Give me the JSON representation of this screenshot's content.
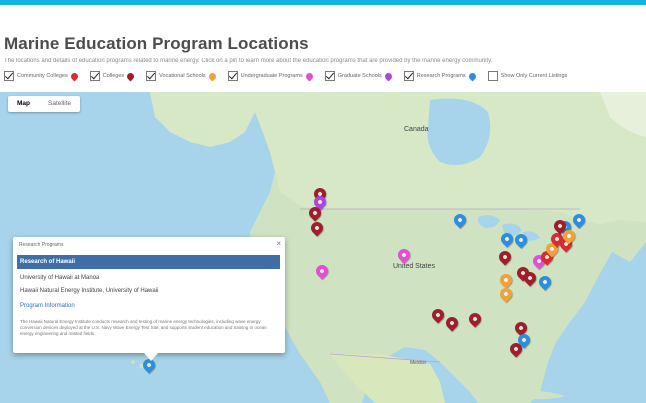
{
  "page": {
    "title": "Marine Education Program Locations",
    "description": "The locations and details of education programs related to marine energy. Click on a pin to learn more about the education programs that are provided by the marine energy community."
  },
  "filters": [
    {
      "label": "Community Colleges",
      "checked": true,
      "color": "#d62e2e"
    },
    {
      "label": "Colleges",
      "checked": true,
      "color": "#9e1f2a"
    },
    {
      "label": "Vocational Schools",
      "checked": true,
      "color": "#f1a13a"
    },
    {
      "label": "Undergraduate Programs",
      "checked": true,
      "color": "#e34fd3"
    },
    {
      "label": "Graduate Schools",
      "checked": true,
      "color": "#b046d9"
    },
    {
      "label": "Research Programs",
      "checked": true,
      "color": "#2d8ee0"
    },
    {
      "label": "Show Only Current Listings",
      "checked": false,
      "color": ""
    }
  ],
  "map": {
    "type_buttons": [
      "Map",
      "Satellite"
    ],
    "active_type": "Map",
    "labels": {
      "canada": "Canada",
      "united_states": "United States",
      "mexico": "Mexico"
    }
  },
  "infowindow": {
    "title": "Research Programs",
    "items": [
      {
        "label": "Research of Hawaii",
        "selected": true
      },
      {
        "label": "University of Hawaii at Manoa",
        "selected": false
      },
      {
        "label": "Hawaii Natural Energy Institute, University of Hawaii",
        "selected": false
      }
    ],
    "link": "Program Information",
    "body": "The Hawaii Natural Energy Institute conducts research and testing of marine energy technologies, including wave energy conversion devices deployed at the U.S. Navy Wave Energy Test Site, and supports student education and training in ocean energy engineering and related fields."
  },
  "pins": [
    {
      "type": "college",
      "color": "#9e1f2a"
    },
    {
      "type": "graduate",
      "color": "#b046d9"
    },
    {
      "type": "college",
      "color": "#9e1f2a"
    },
    {
      "type": "college",
      "color": "#9e1f2a"
    },
    {
      "type": "undergraduate",
      "color": "#e34fd3"
    },
    {
      "type": "research",
      "color": "#2d8ee0"
    },
    {
      "type": "undergraduate",
      "color": "#e34fd3"
    },
    {
      "type": "research",
      "color": "#2d8ee0"
    },
    {
      "type": "research",
      "color": "#2d8ee0"
    },
    {
      "type": "college",
      "color": "#9e1f2a"
    },
    {
      "type": "vocational",
      "color": "#f1a13a"
    },
    {
      "type": "vocational",
      "color": "#f1a13a"
    },
    {
      "type": "college",
      "color": "#9e1f2a"
    },
    {
      "type": "college",
      "color": "#9e1f2a"
    },
    {
      "type": "research",
      "color": "#2d8ee0"
    },
    {
      "type": "undergraduate",
      "color": "#e34fd3"
    },
    {
      "type": "community",
      "color": "#d62e2e"
    },
    {
      "type": "vocational",
      "color": "#f1a13a"
    },
    {
      "type": "community",
      "color": "#d62e2e"
    },
    {
      "type": "research",
      "color": "#2d8ee0"
    },
    {
      "type": "research",
      "color": "#2d8ee0"
    },
    {
      "type": "college",
      "color": "#9e1f2a"
    },
    {
      "type": "community",
      "color": "#d62e2e"
    },
    {
      "type": "vocational",
      "color": "#f1a13a"
    },
    {
      "type": "college",
      "color": "#9e1f2a"
    },
    {
      "type": "college",
      "color": "#9e1f2a"
    },
    {
      "type": "college",
      "color": "#9e1f2a"
    },
    {
      "type": "college",
      "color": "#9e1f2a"
    },
    {
      "type": "research",
      "color": "#2d8ee0"
    },
    {
      "type": "college",
      "color": "#9e1f2a"
    },
    {
      "type": "research",
      "color": "#2d8ee0"
    }
  ]
}
